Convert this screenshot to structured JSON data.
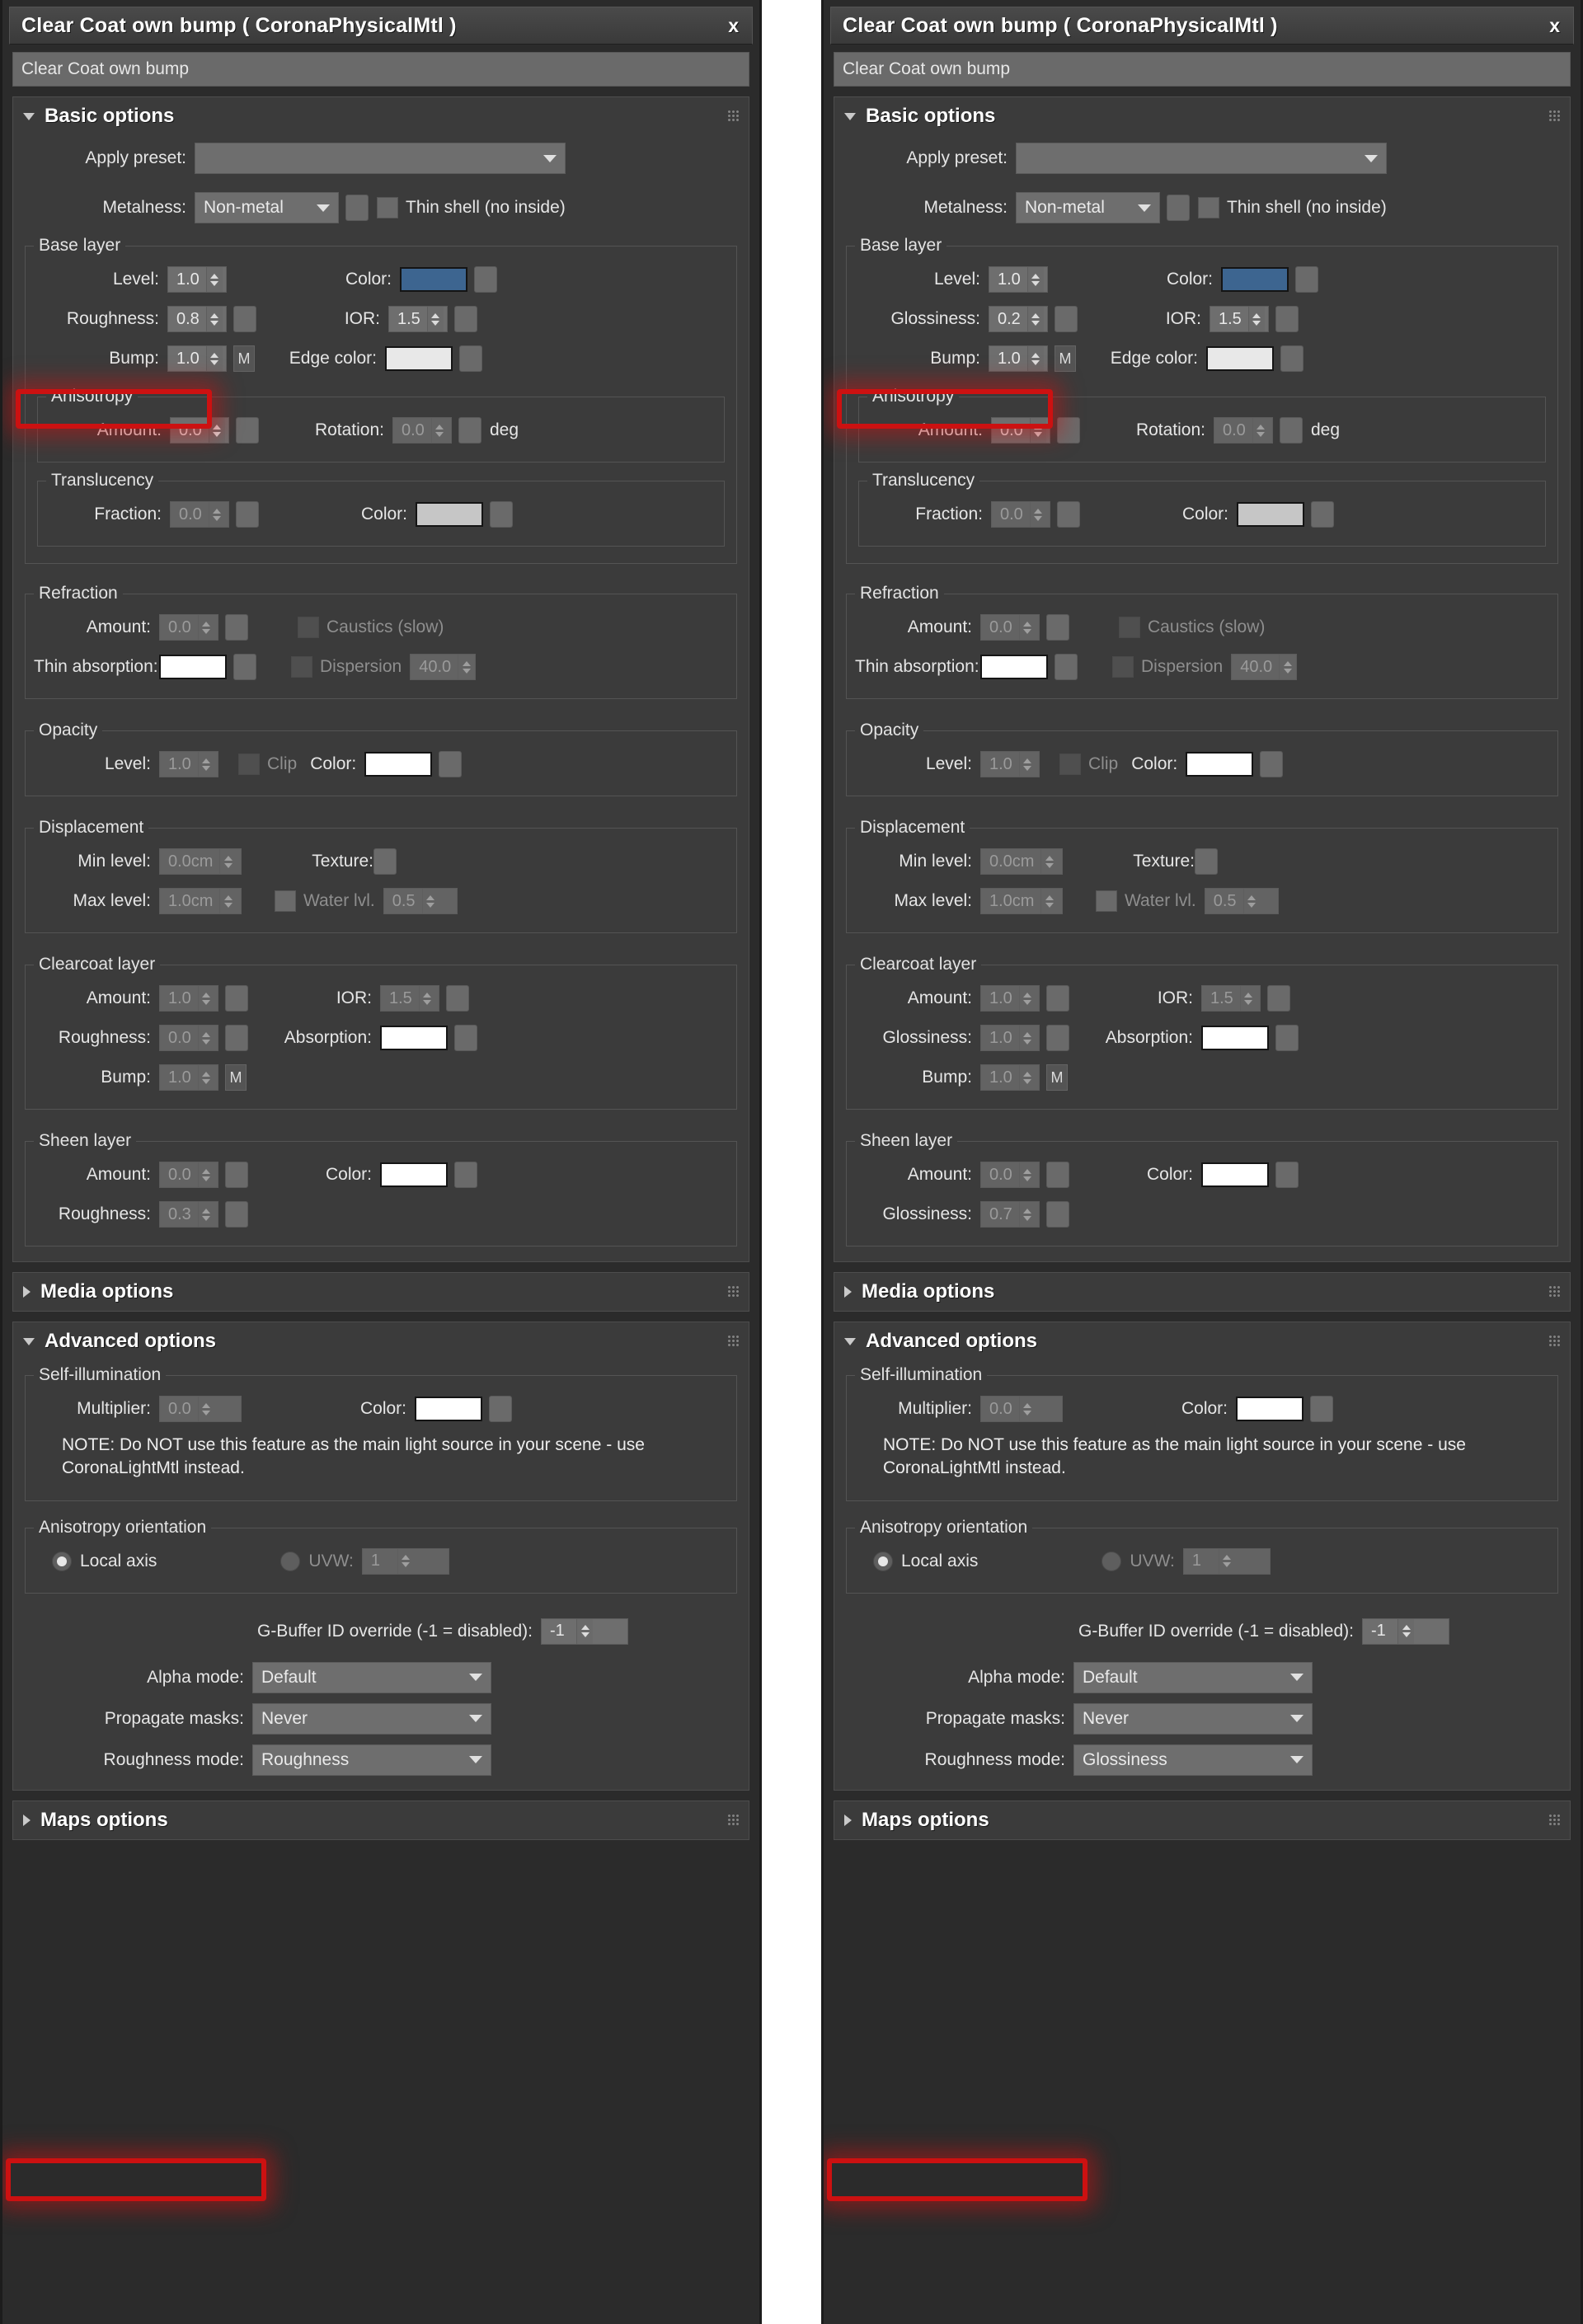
{
  "panels": [
    {
      "id": "left",
      "title": "Clear Coat own bump  ( CoronaPhysicalMtl )",
      "close_label": "x",
      "material_name": "Clear Coat own bump",
      "rollouts": {
        "basic": "Basic options",
        "media": "Media options",
        "advanced": "Advanced options",
        "maps": "Maps options"
      },
      "basic": {
        "apply_preset_label": "Apply preset:",
        "apply_preset_value": "",
        "metalness_label": "Metalness:",
        "metalness_value": "Non-metal",
        "thin_shell_label": "Thin shell (no inside)"
      },
      "base_layer": {
        "group_label": "Base layer",
        "level_label": "Level:",
        "level_value": "1.0",
        "color_label": "Color:",
        "color_value": "#3d6590",
        "gloss_label": "Roughness:",
        "gloss_value": "0.8",
        "ior_label": "IOR:",
        "ior_value": "1.5",
        "bump_label": "Bump:",
        "bump_value": "1.0",
        "bump_map_label": "M",
        "edge_color_label": "Edge color:",
        "edge_color_value": "#e8e8e8"
      },
      "anisotropy": {
        "group_label": "Anisotropy",
        "amount_label": "Amount:",
        "amount_value": "0.0",
        "rotation_label": "Rotation:",
        "rotation_value": "0.0",
        "deg_label": "deg"
      },
      "translucency": {
        "group_label": "Translucency",
        "fraction_label": "Fraction:",
        "fraction_value": "0.0",
        "color_label": "Color:",
        "color_value": "#c6c6c6"
      },
      "refraction": {
        "group_label": "Refraction",
        "amount_label": "Amount:",
        "amount_value": "0.0",
        "caustics_label": "Caustics (slow)",
        "thin_absorption_label": "Thin absorption:",
        "thin_absorption_value": "#ffffff",
        "dispersion_label": "Dispersion",
        "dispersion_value": "40.0"
      },
      "opacity": {
        "group_label": "Opacity",
        "level_label": "Level:",
        "level_value": "1.0",
        "clip_label": "Clip",
        "color_label": "Color:",
        "color_value": "#ffffff"
      },
      "displacement": {
        "group_label": "Displacement",
        "min_level_label": "Min level:",
        "min_level_value": "0.0cm",
        "texture_label": "Texture:",
        "max_level_label": "Max level:",
        "max_level_value": "1.0cm",
        "water_label": "Water lvl.",
        "water_value": "0.5"
      },
      "clearcoat": {
        "group_label": "Clearcoat layer",
        "amount_label": "Amount:",
        "amount_value": "1.0",
        "ior_label": "IOR:",
        "ior_value": "1.5",
        "gloss_label": "Roughness:",
        "gloss_value": "0.0",
        "absorption_label": "Absorption:",
        "absorption_value": "#ffffff",
        "bump_label": "Bump:",
        "bump_value": "1.0",
        "bump_map_label": "M"
      },
      "sheen": {
        "group_label": "Sheen layer",
        "amount_label": "Amount:",
        "amount_value": "0.0",
        "color_label": "Color:",
        "color_value": "#ffffff",
        "gloss_label": "Roughness:",
        "gloss_value": "0.3"
      },
      "self_illum": {
        "group_label": "Self-illumination",
        "multiplier_label": "Multiplier:",
        "multiplier_value": "0.0",
        "color_label": "Color:",
        "color_value": "#ffffff",
        "note": "NOTE: Do NOT use this feature as the main light source in your scene - use CoronaLightMtl instead."
      },
      "aniso_orient": {
        "group_label": "Anisotropy orientation",
        "local_axis_label": "Local axis",
        "uvw_label": "UVW:",
        "uvw_value": "1"
      },
      "advanced": {
        "gbuffer_label": "G-Buffer ID override (-1 = disabled):",
        "gbuffer_value": "-1",
        "alpha_mode_label": "Alpha mode:",
        "alpha_mode_value": "Default",
        "propagate_label": "Propagate masks:",
        "propagate_value": "Never",
        "roughness_mode_label": "Roughness mode:",
        "roughness_mode_value": "Roughness"
      }
    },
    {
      "id": "right",
      "title": "Clear Coat own bump  ( CoronaPhysicalMtl )",
      "close_label": "x",
      "material_name": "Clear Coat own bump",
      "rollouts": {
        "basic": "Basic options",
        "media": "Media options",
        "advanced": "Advanced options",
        "maps": "Maps options"
      },
      "basic": {
        "apply_preset_label": "Apply preset:",
        "apply_preset_value": "",
        "metalness_label": "Metalness:",
        "metalness_value": "Non-metal",
        "thin_shell_label": "Thin shell (no inside)"
      },
      "base_layer": {
        "group_label": "Base layer",
        "level_label": "Level:",
        "level_value": "1.0",
        "color_label": "Color:",
        "color_value": "#3d6590",
        "gloss_label": "Glossiness:",
        "gloss_value": "0.2",
        "ior_label": "IOR:",
        "ior_value": "1.5",
        "bump_label": "Bump:",
        "bump_value": "1.0",
        "bump_map_label": "M",
        "edge_color_label": "Edge color:",
        "edge_color_value": "#e8e8e8"
      },
      "anisotropy": {
        "group_label": "Anisotropy",
        "amount_label": "Amount:",
        "amount_value": "0.0",
        "rotation_label": "Rotation:",
        "rotation_value": "0.0",
        "deg_label": "deg"
      },
      "translucency": {
        "group_label": "Translucency",
        "fraction_label": "Fraction:",
        "fraction_value": "0.0",
        "color_label": "Color:",
        "color_value": "#c6c6c6"
      },
      "refraction": {
        "group_label": "Refraction",
        "amount_label": "Amount:",
        "amount_value": "0.0",
        "caustics_label": "Caustics (slow)",
        "thin_absorption_label": "Thin absorption:",
        "thin_absorption_value": "#ffffff",
        "dispersion_label": "Dispersion",
        "dispersion_value": "40.0"
      },
      "opacity": {
        "group_label": "Opacity",
        "level_label": "Level:",
        "level_value": "1.0",
        "clip_label": "Clip",
        "color_label": "Color:",
        "color_value": "#ffffff"
      },
      "displacement": {
        "group_label": "Displacement",
        "min_level_label": "Min level:",
        "min_level_value": "0.0cm",
        "texture_label": "Texture:",
        "max_level_label": "Max level:",
        "max_level_value": "1.0cm",
        "water_label": "Water lvl.",
        "water_value": "0.5"
      },
      "clearcoat": {
        "group_label": "Clearcoat layer",
        "amount_label": "Amount:",
        "amount_value": "1.0",
        "ior_label": "IOR:",
        "ior_value": "1.5",
        "gloss_label": "Glossiness:",
        "gloss_value": "1.0",
        "absorption_label": "Absorption:",
        "absorption_value": "#ffffff",
        "bump_label": "Bump:",
        "bump_value": "1.0",
        "bump_map_label": "M"
      },
      "sheen": {
        "group_label": "Sheen layer",
        "amount_label": "Amount:",
        "amount_value": "0.0",
        "color_label": "Color:",
        "color_value": "#ffffff",
        "gloss_label": "Glossiness:",
        "gloss_value": "0.7"
      },
      "self_illum": {
        "group_label": "Self-illumination",
        "multiplier_label": "Multiplier:",
        "multiplier_value": "0.0",
        "color_label": "Color:",
        "color_value": "#ffffff",
        "note": "NOTE: Do NOT use this feature as the main light source in your scene - use CoronaLightMtl instead."
      },
      "aniso_orient": {
        "group_label": "Anisotropy orientation",
        "local_axis_label": "Local axis",
        "uvw_label": "UVW:",
        "uvw_value": "1"
      },
      "advanced": {
        "gbuffer_label": "G-Buffer ID override (-1 = disabled):",
        "gbuffer_value": "-1",
        "alpha_mode_label": "Alpha mode:",
        "alpha_mode_value": "Default",
        "propagate_label": "Propagate masks:",
        "propagate_value": "Never",
        "roughness_mode_label": "Roughness mode:",
        "roughness_mode_value": "Glossiness"
      }
    }
  ],
  "annotations": {
    "highlight_color": "#cc1111",
    "regions": [
      {
        "panel": "left",
        "target": "base-layer-roughness-row"
      },
      {
        "panel": "left",
        "target": "roughness-mode-row"
      },
      {
        "panel": "right",
        "target": "base-layer-glossiness-row"
      },
      {
        "panel": "right",
        "target": "roughness-mode-row"
      }
    ]
  }
}
